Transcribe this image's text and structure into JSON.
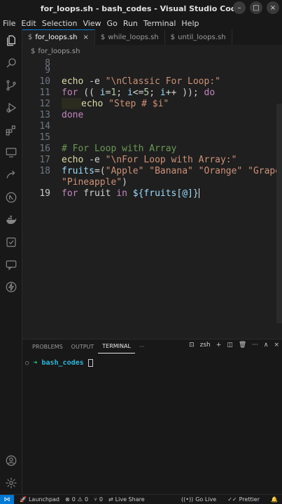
{
  "window": {
    "title": "for_loops.sh - bash_codes - Visual Studio Code"
  },
  "menu": [
    "File",
    "Edit",
    "Selection",
    "View",
    "Go",
    "Run",
    "Terminal",
    "Help"
  ],
  "tabs": [
    {
      "label": "for_loops.sh",
      "active": true,
      "close": "×"
    },
    {
      "label": "while_loops.sh",
      "active": false
    },
    {
      "label": "until_loops.sh",
      "active": false
    }
  ],
  "breadcrumb": "for_loops.sh",
  "editor": {
    "line_numbers": [
      "8",
      "9",
      "10",
      "11",
      "12",
      "13",
      "14",
      "15",
      "16",
      "17",
      "18",
      "19"
    ],
    "code": {
      "l10_cmd": "echo",
      "l10_flag": " -e ",
      "l10_str": "\"\\nClassic For Loop:\"",
      "l11_for": "for",
      "l11_rest": " (( ",
      "l11_var": "i",
      "l11_eq": "=",
      "l11_n1": "1",
      "l11_mid": "; ",
      "l11_var2": "i",
      "l11_lt": "<=",
      "l11_n5": "5",
      "l11_mid2": "; ",
      "l11_var3": "i",
      "l11_inc": "++ )); ",
      "l11_do": "do",
      "l12_cmd": "echo",
      "l12_str": " \"Step # $i\"",
      "l13_done": "done",
      "l16_cmt": "# For Loop with Array",
      "l17_cmd": "echo",
      "l17_flag": " -e ",
      "l17_str": "\"\\nFor Loop with Array:\"",
      "l18_var": "fruits",
      "l18_eq": "=(",
      "l18_items": "\"Apple\" \"Banana\" \"Orange\" \"Grape\"",
      "l18b_items": "\"Pineapple\"",
      "l18b_close": ")",
      "l19_for": "for",
      "l19_fruit": " fruit ",
      "l19_in": "in",
      "l19_expr": " ${fruits[@]}"
    }
  },
  "panel": {
    "tabs": [
      "PROBLEMS",
      "OUTPUT",
      "TERMINAL",
      "···"
    ],
    "shell": "zsh",
    "terminal": {
      "dot": "○",
      "arrow": "➜",
      "dir": "bash_codes"
    }
  },
  "statusbar": {
    "launchpad": "Launchpad",
    "errors": "0",
    "warnings": "0",
    "ports": "0",
    "live_share": "Live Share",
    "go_live": "Go Live",
    "prettier": "Prettier"
  }
}
